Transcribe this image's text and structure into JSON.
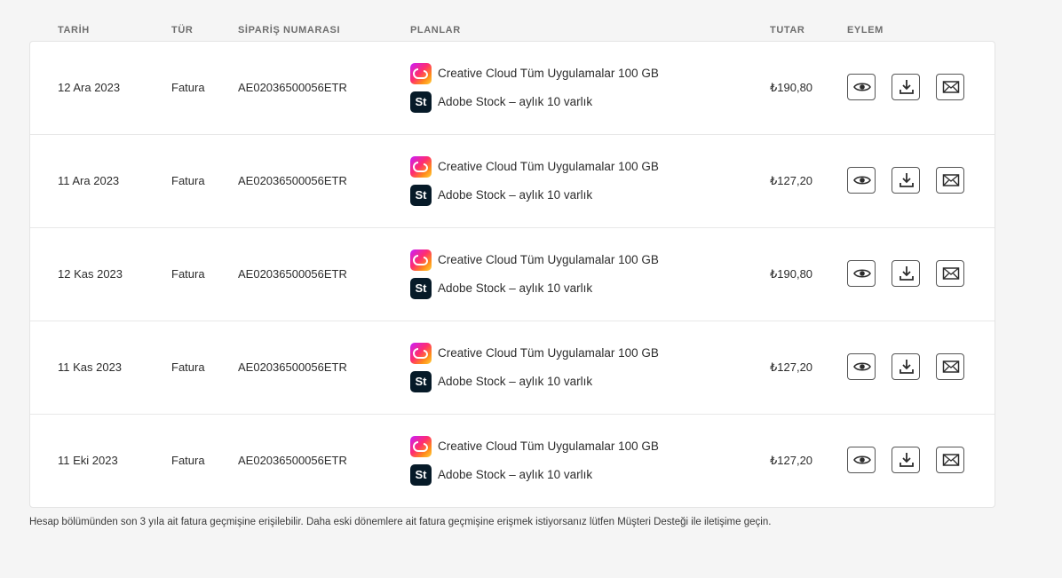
{
  "table": {
    "headers": {
      "date": "TARİH",
      "type": "TÜR",
      "order": "SİPARİŞ NUMARASI",
      "plans": "PLANLAR",
      "amount": "TUTAR",
      "action": "EYLEM"
    },
    "rows": [
      {
        "date": "12 Ara 2023",
        "type": "Fatura",
        "order": "AE02036500056ETR",
        "plan1": "Creative Cloud Tüm Uygulamalar 100 GB",
        "plan2": "Adobe Stock – aylık 10 varlık",
        "amount": "₺190,80"
      },
      {
        "date": "11 Ara 2023",
        "type": "Fatura",
        "order": "AE02036500056ETR",
        "plan1": "Creative Cloud Tüm Uygulamalar 100 GB",
        "plan2": "Adobe Stock – aylık 10 varlık",
        "amount": "₺127,20"
      },
      {
        "date": "12 Kas 2023",
        "type": "Fatura",
        "order": "AE02036500056ETR",
        "plan1": "Creative Cloud Tüm Uygulamalar 100 GB",
        "plan2": "Adobe Stock – aylık 10 varlık",
        "amount": "₺190,80"
      },
      {
        "date": "11 Kas 2023",
        "type": "Fatura",
        "order": "AE02036500056ETR",
        "plan1": "Creative Cloud Tüm Uygulamalar 100 GB",
        "plan2": "Adobe Stock – aylık 10 varlık",
        "amount": "₺127,20"
      },
      {
        "date": "11 Eki 2023",
        "type": "Fatura",
        "order": "AE02036500056ETR",
        "plan1": "Creative Cloud Tüm Uygulamalar 100 GB",
        "plan2": "Adobe Stock – aylık 10 varlık",
        "amount": "₺127,20"
      }
    ]
  },
  "icons": {
    "cc": "creative-cloud-icon",
    "stock": "adobe-stock-icon",
    "stock_letters": "St",
    "view": "eye-icon",
    "download": "download-icon",
    "email": "envelope-icon"
  },
  "colors": {
    "stock_bg": "#061a28",
    "page_bg": "#f5f5f5"
  },
  "footnote": "Hesap bölümünden son 3 yıla ait fatura geçmişine erişilebilir. Daha eski dönemlere ait fatura geçmişine erişmek istiyorsanız lütfen Müşteri Desteği ile iletişime geçin."
}
